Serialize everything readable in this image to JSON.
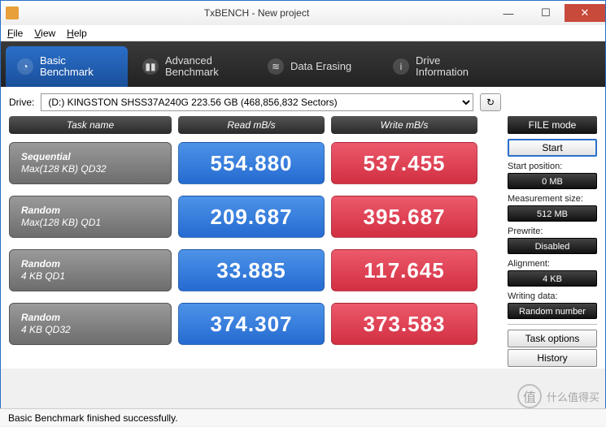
{
  "window": {
    "title": "TxBENCH - New project",
    "minimize": "—",
    "maximize": "☐",
    "close": "✕"
  },
  "menu": {
    "file": "File",
    "view": "View",
    "help": "Help"
  },
  "tabs": {
    "basic": "Basic\nBenchmark",
    "advanced": "Advanced\nBenchmark",
    "erase": "Data Erasing",
    "drive": "Drive\nInformation"
  },
  "drive": {
    "label": "Drive:",
    "selected": "(D:) KINGSTON SHSS37A240G   223.56 GB (468,856,832 Sectors)"
  },
  "headers": {
    "task": "Task name",
    "read": "Read mB/s",
    "write": "Write mB/s"
  },
  "rows": [
    {
      "l1": "Sequential",
      "l2": "Max(128 KB) QD32",
      "read": "554.880",
      "write": "537.455"
    },
    {
      "l1": "Random",
      "l2": "Max(128 KB) QD1",
      "read": "209.687",
      "write": "395.687"
    },
    {
      "l1": "Random",
      "l2": "4 KB QD1",
      "read": "33.885",
      "write": "117.645"
    },
    {
      "l1": "Random",
      "l2": "4 KB QD32",
      "read": "374.307",
      "write": "373.583"
    }
  ],
  "side": {
    "filemode": "FILE mode",
    "start": "Start",
    "startpos_lbl": "Start position:",
    "startpos": "0 MB",
    "msize_lbl": "Measurement size:",
    "msize": "512 MB",
    "prewrite_lbl": "Prewrite:",
    "prewrite": "Disabled",
    "align_lbl": "Alignment:",
    "align": "4 KB",
    "wdata_lbl": "Writing data:",
    "wdata": "Random number",
    "taskopt": "Task options",
    "history": "History"
  },
  "status": "Basic Benchmark finished successfully.",
  "watermark": "什么值得买"
}
